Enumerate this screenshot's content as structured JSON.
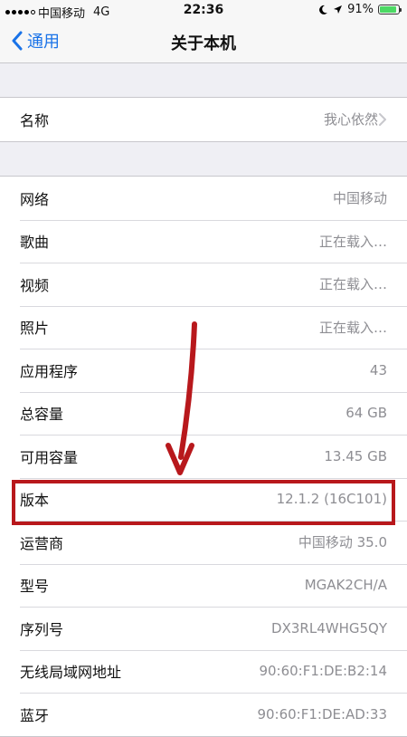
{
  "status_bar": {
    "carrier": "中国移动",
    "network": "4G",
    "time": "22:36",
    "battery_percent": "91%",
    "battery_level": 0.91,
    "battery_color": "#4cd964"
  },
  "nav": {
    "back_label": "通用",
    "title": "关于本机"
  },
  "name_row": {
    "label": "名称",
    "value": "我心依然"
  },
  "info_rows": [
    {
      "label": "网络",
      "value": "中国移动"
    },
    {
      "label": "歌曲",
      "value": "正在载入…"
    },
    {
      "label": "视频",
      "value": "正在载入…"
    },
    {
      "label": "照片",
      "value": "正在载入…"
    },
    {
      "label": "应用程序",
      "value": "43"
    },
    {
      "label": "总容量",
      "value": "64 GB"
    },
    {
      "label": "可用容量",
      "value": "13.45 GB"
    },
    {
      "label": "版本",
      "value": "12.1.2 (16C101)"
    },
    {
      "label": "运营商",
      "value": "中国移动 35.0"
    },
    {
      "label": "型号",
      "value": "MGAK2CH/A"
    },
    {
      "label": "序列号",
      "value": "DX3RL4WHG5QY"
    },
    {
      "label": "无线局域网地址",
      "value": "90:60:F1:DE:B2:14"
    },
    {
      "label": "蓝牙",
      "value": "90:60:F1:DE:AD:33"
    }
  ],
  "colors": {
    "accent": "#1a73e8",
    "annotation_red": "#b8181c"
  },
  "icons": {
    "back": "chevron-left-icon",
    "disclosure": "chevron-right-icon",
    "moon": "moon-icon",
    "location": "location-arrow-icon"
  }
}
